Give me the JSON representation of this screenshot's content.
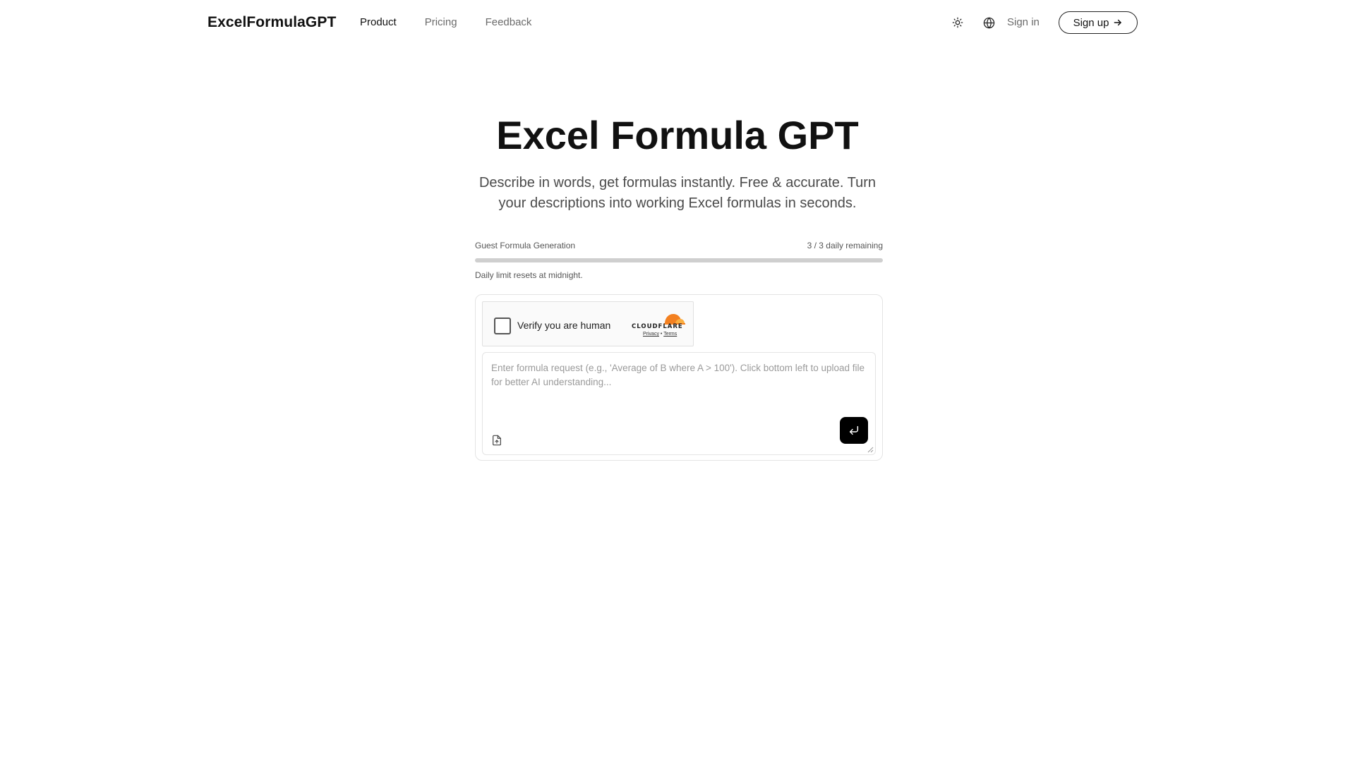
{
  "header": {
    "logo": "ExcelFormulaGPT",
    "nav": [
      {
        "label": "Product",
        "active": true
      },
      {
        "label": "Pricing",
        "active": false
      },
      {
        "label": "Feedback",
        "active": false
      }
    ],
    "theme_icon": "sun-icon",
    "language_icon": "globe-icon",
    "sign_in_label": "Sign in",
    "sign_up_label": "Sign up",
    "sign_up_icon": "arrow-right-icon"
  },
  "hero": {
    "title": "Excel Formula GPT",
    "subtitle": "Describe in words, get formulas instantly. Free & accurate. Turn your descriptions into working Excel formulas in seconds."
  },
  "usage": {
    "label": "Guest Formula Generation",
    "remaining_text": "3 / 3 daily remaining",
    "used_fraction": 1.0,
    "note": "Daily limit resets at midnight."
  },
  "captcha": {
    "label": "Verify you are human",
    "brand": "CLOUDFLARE",
    "privacy_label": "Privacy",
    "separator": "•",
    "terms_label": "Terms",
    "checked": false
  },
  "input": {
    "placeholder": "Enter formula request (e.g., 'Average of B where A > 100'). Click bottom left to upload file for better AI understanding...",
    "upload_icon": "file-upload-icon",
    "send_icon": "enter-icon"
  },
  "colors": {
    "text_primary": "#111111",
    "text_muted": "#6b6b6b",
    "progress_track": "#e6e6e6",
    "progress_fill": "#cfcfcf",
    "cloudflare_orange": "#f38020",
    "send_button": "#000000"
  }
}
